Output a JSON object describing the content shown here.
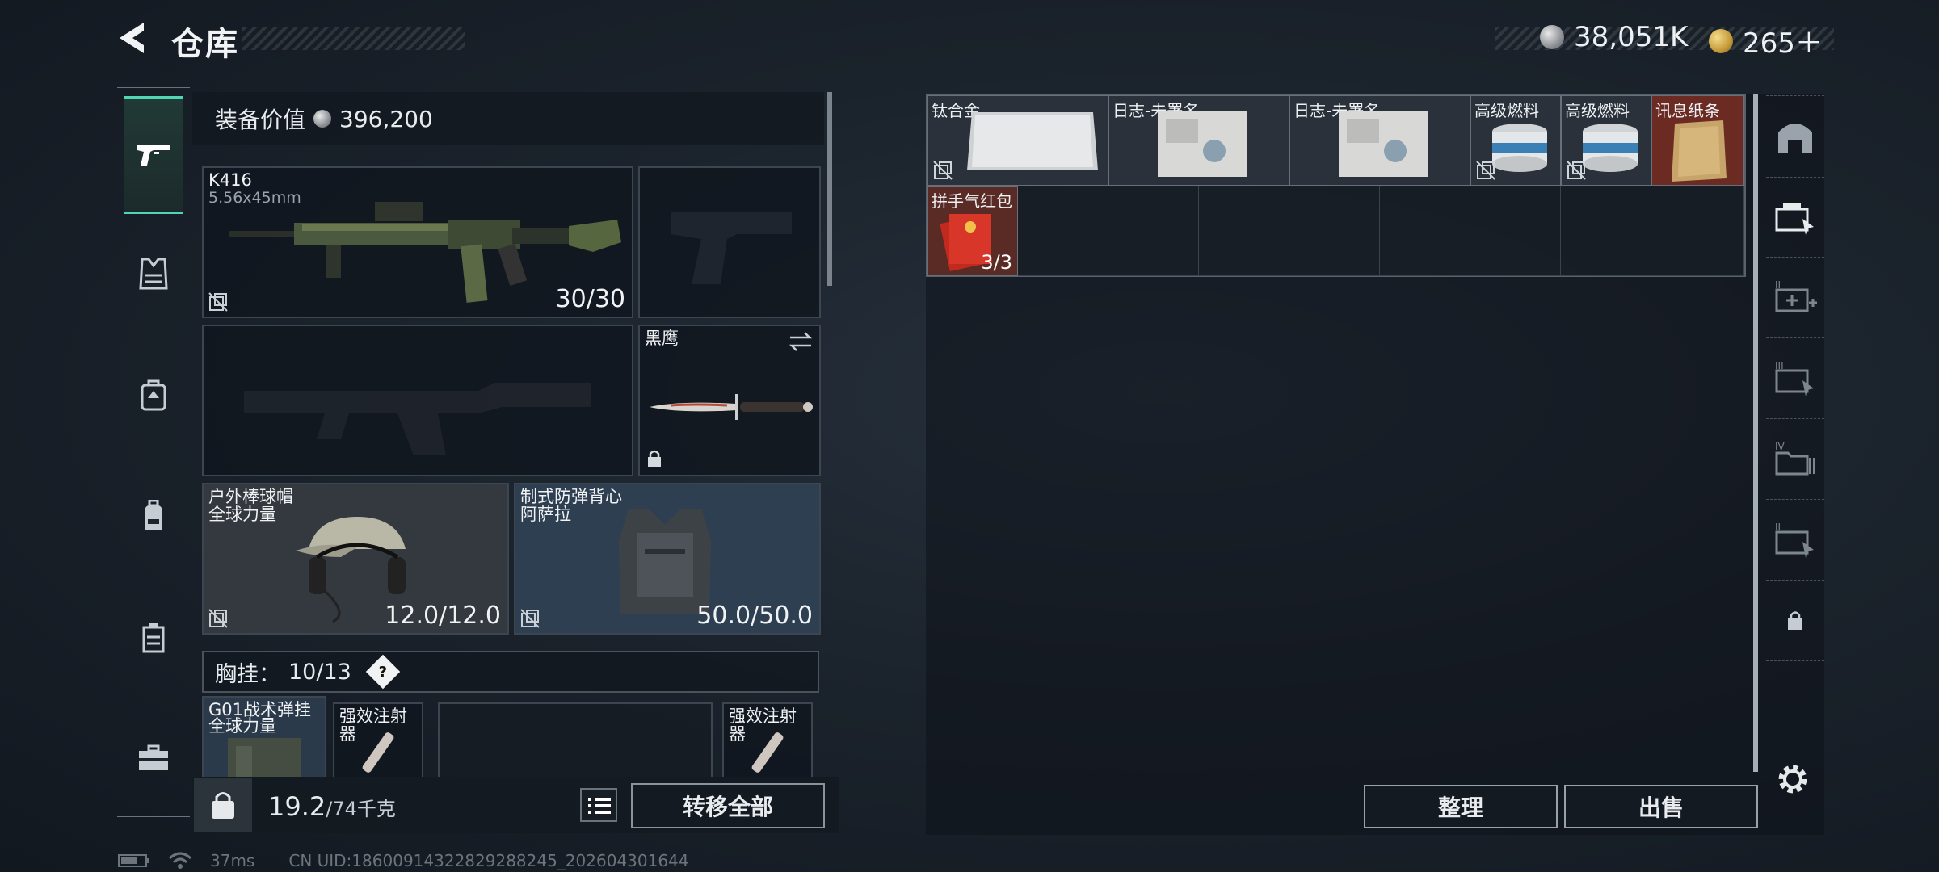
{
  "header": {
    "title": "仓库",
    "currency_silver": "38,051K",
    "currency_gold": "265＋"
  },
  "left_nav": {
    "tabs": [
      "weapon-icon",
      "armor-icon",
      "backpack-small-icon",
      "helmet-bag-icon",
      "container-icon",
      "case-icon"
    ]
  },
  "equipment": {
    "value_label": "装备价值",
    "value": "396,200",
    "primary_weapon": {
      "name": "K416",
      "caliber": "5.56x45mm",
      "ammo": "30/30"
    },
    "melee": {
      "name": "黑鹰"
    },
    "helmet": {
      "name": "户外棒球帽",
      "faction": "全球力量",
      "durability": "12.0/12.0"
    },
    "armor": {
      "name": "制式防弹背心",
      "faction": "阿萨拉",
      "durability": "50.0/50.0"
    },
    "chest_rig": {
      "label": "胸挂：",
      "capacity": "10/13",
      "help": "?"
    },
    "chest_item": {
      "name": "G01战术弹挂",
      "faction": "全球力量"
    },
    "injector1": {
      "name": "强效注射器"
    },
    "injector2": {
      "name": "强效注射器"
    }
  },
  "footer_left": {
    "weight": "19.2",
    "weight_max": "/74千克",
    "transfer_all": "转移全部"
  },
  "storage": {
    "items": [
      {
        "name": "钛合金",
        "count": ""
      },
      {
        "name": "日志-未署名",
        "count": ""
      },
      {
        "name": "日志-未署名",
        "count": ""
      },
      {
        "name": "高级燃料",
        "count": ""
      },
      {
        "name": "高级燃料",
        "count": ""
      },
      {
        "name": "讯息纸条",
        "count": ""
      },
      {
        "name": "拼手气红包",
        "count": "3/3"
      }
    ],
    "sort_label": "整理",
    "sell_label": "出售"
  },
  "status_bar": {
    "ping": "37ms",
    "uid": "CN UID:18600914322829288245_202604301644"
  },
  "colors": {
    "accent": "#4fd6b4",
    "rare_red": "#6b2a22",
    "armor_blue": "#2e3f52"
  }
}
